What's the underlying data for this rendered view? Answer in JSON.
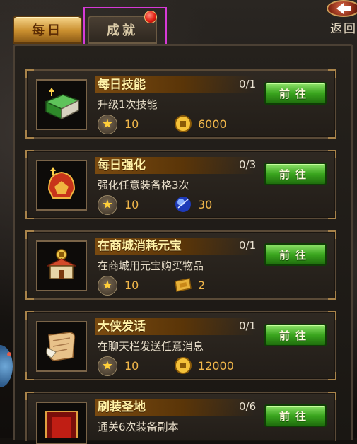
{
  "tabs": {
    "daily_label": "每日",
    "achievement_label": "成就"
  },
  "back": {
    "label": "返回"
  },
  "tasks": [
    {
      "title": "每日技能",
      "progress": "0/1",
      "desc": "升级1次技能",
      "star_value": "10",
      "reward_icon": "coin-icon",
      "reward_value": "6000",
      "button": "前往",
      "item_icon": "skill-book-icon"
    },
    {
      "title": "每日强化",
      "progress": "0/3",
      "desc": "强化任意装备格3次",
      "star_value": "10",
      "reward_icon": "blue-gem-icon",
      "reward_value": "30",
      "button": "前往",
      "item_icon": "helmet-icon"
    },
    {
      "title": "在商城消耗元宝",
      "progress": "0/1",
      "desc": "在商城用元宝购买物品",
      "star_value": "10",
      "reward_icon": "ticket-icon",
      "reward_value": "2",
      "button": "前往",
      "item_icon": "shop-icon"
    },
    {
      "title": "大侠发话",
      "progress": "0/1",
      "desc": "在聊天栏发送任意消息",
      "star_value": "10",
      "reward_icon": "coin-icon",
      "reward_value": "12000",
      "button": "前往",
      "item_icon": "scroll-icon"
    },
    {
      "title": "刷装圣地",
      "progress": "0/6",
      "desc": "通关6次装备副本",
      "star_value": "",
      "reward_icon": "",
      "reward_value": "",
      "button": "前往",
      "item_icon": "gate-icon"
    }
  ],
  "colors": {
    "accent_gold": "#f0b64a",
    "button_green": "#3aa51e",
    "highlight": "#d63ad6"
  }
}
